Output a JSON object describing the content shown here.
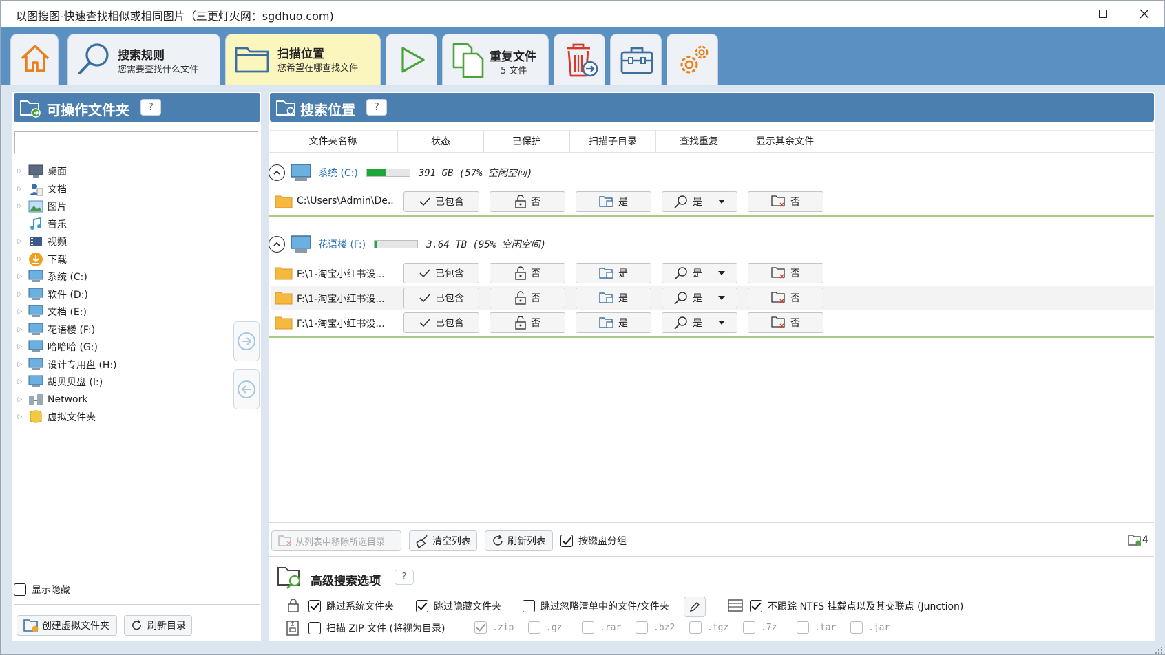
{
  "window": {
    "title": "以图搜图-快速查找相似或相同图片（三更灯火网：sgdhuo.com)"
  },
  "ribbon": {
    "home_icon": "home-icon",
    "tabs": [
      {
        "title": "搜索规则",
        "subtitle": "您需要查找什么文件",
        "icon": "search-icon"
      },
      {
        "title": "扫描位置",
        "subtitle": "您希望在哪查找文件",
        "icon": "folder-icon",
        "active": true
      },
      {
        "title": "",
        "subtitle": "",
        "icon": "play-icon"
      },
      {
        "title": "重复文件",
        "subtitle": "5 文件",
        "icon": "duplicate-files-icon"
      },
      {
        "title": "",
        "subtitle": "",
        "icon": "trash-icon"
      },
      {
        "title": "",
        "subtitle": "",
        "icon": "toolbox-icon"
      },
      {
        "title": "",
        "subtitle": "",
        "icon": "settings-gears-icon"
      }
    ]
  },
  "left_panel": {
    "title": "可操作文件夹",
    "help": "?",
    "search_value": "",
    "tree": [
      {
        "label": "桌面",
        "icon": "desktop-icon",
        "expandable": true
      },
      {
        "label": "文档",
        "icon": "documents-icon",
        "expandable": true
      },
      {
        "label": "图片",
        "icon": "pictures-icon",
        "expandable": true
      },
      {
        "label": "音乐",
        "icon": "music-icon",
        "expandable": false
      },
      {
        "label": "视频",
        "icon": "videos-icon",
        "expandable": true
      },
      {
        "label": "下载",
        "icon": "downloads-icon",
        "expandable": true
      },
      {
        "label": "系统 (C:)",
        "icon": "drive-icon",
        "expandable": true
      },
      {
        "label": "软件 (D:)",
        "icon": "drive-icon",
        "expandable": true
      },
      {
        "label": "文档 (E:)",
        "icon": "drive-icon",
        "expandable": true
      },
      {
        "label": "花语楼 (F:)",
        "icon": "drive-icon",
        "expandable": true
      },
      {
        "label": "哈哈哈 (G:)",
        "icon": "drive-icon",
        "expandable": true
      },
      {
        "label": "设计专用盘 (H:)",
        "icon": "drive-icon",
        "expandable": true
      },
      {
        "label": "胡贝贝盘 (I:)",
        "icon": "drive-icon",
        "expandable": true
      },
      {
        "label": "Network",
        "icon": "network-icon",
        "expandable": true
      },
      {
        "label": "虚拟文件夹",
        "icon": "virtual-folder-icon",
        "expandable": true
      }
    ],
    "show_hidden_label": "显示隐藏",
    "show_hidden_checked": false,
    "create_virtual_label": "创建虚拟文件夹",
    "refresh_dir_label": "刷新目录"
  },
  "right_panel": {
    "title": "搜索位置",
    "help": "?",
    "columns": [
      "文件夹名称",
      "状态",
      "已保护",
      "扫描子目录",
      "查找重复",
      "显示其余文件"
    ],
    "groups": [
      {
        "drive": "系统 (C:)",
        "usage_percent_used": 43,
        "info": "391 GB (57% 空闲空间)",
        "entries": [
          {
            "path": "C:\\Users\\Admin\\De...",
            "status": "已包含",
            "protected": "否",
            "subdirs": "是",
            "find_dup": "是",
            "show_other": "否"
          }
        ]
      },
      {
        "drive": "花语楼 (F:)",
        "usage_percent_used": 5,
        "info": "3.64 TB (95% 空闲空间)",
        "entries": [
          {
            "path": "F:\\1-淘宝小红书设...",
            "status": "已包含",
            "protected": "否",
            "subdirs": "是",
            "find_dup": "是",
            "show_other": "否"
          },
          {
            "path": "F:\\1-淘宝小红书设...",
            "status": "已包含",
            "protected": "否",
            "subdirs": "是",
            "find_dup": "是",
            "show_other": "否"
          },
          {
            "path": "F:\\1-淘宝小红书设...",
            "status": "已包含",
            "protected": "否",
            "subdirs": "是",
            "find_dup": "是",
            "show_other": "否"
          }
        ]
      }
    ],
    "toolbar": {
      "remove_label": "从列表中移除所选目录",
      "clear_label": "清空列表",
      "refresh_label": "刷新列表",
      "group_by_disk_label": "按磁盘分组",
      "group_by_disk_checked": true,
      "folder_count": "4"
    },
    "advanced": {
      "title": "高级搜索选项",
      "help": "?",
      "skip_system": {
        "label": "跳过系统文件夹",
        "checked": true
      },
      "skip_hidden": {
        "label": "跳过隐藏文件夹",
        "checked": true
      },
      "skip_ignore": {
        "label": "跳过忽略清单中的文件/文件夹",
        "checked": false
      },
      "no_ntfs": {
        "label": "不跟踪 NTFS 挂载点以及其交联点 (Junction)",
        "checked": true
      },
      "scan_zip": {
        "label": "扫描 ZIP 文件 (将视为目录)",
        "checked": false
      },
      "extensions": [
        {
          "label": ".zip",
          "checked": true
        },
        {
          "label": ".gz",
          "checked": false
        },
        {
          "label": ".rar",
          "checked": false
        },
        {
          "label": ".bz2",
          "checked": false
        },
        {
          "label": ".tgz",
          "checked": false
        },
        {
          "label": ".7z",
          "checked": false
        },
        {
          "label": ".tar",
          "checked": false
        },
        {
          "label": ".jar",
          "checked": false
        }
      ]
    }
  },
  "colors": {
    "ribbon_bg": "#5b91c2",
    "panel_header": "#4a7fb0",
    "active_tab": "#fbf6bd",
    "usage_green": "#1ea83c",
    "drive_link": "#2a70b8"
  }
}
